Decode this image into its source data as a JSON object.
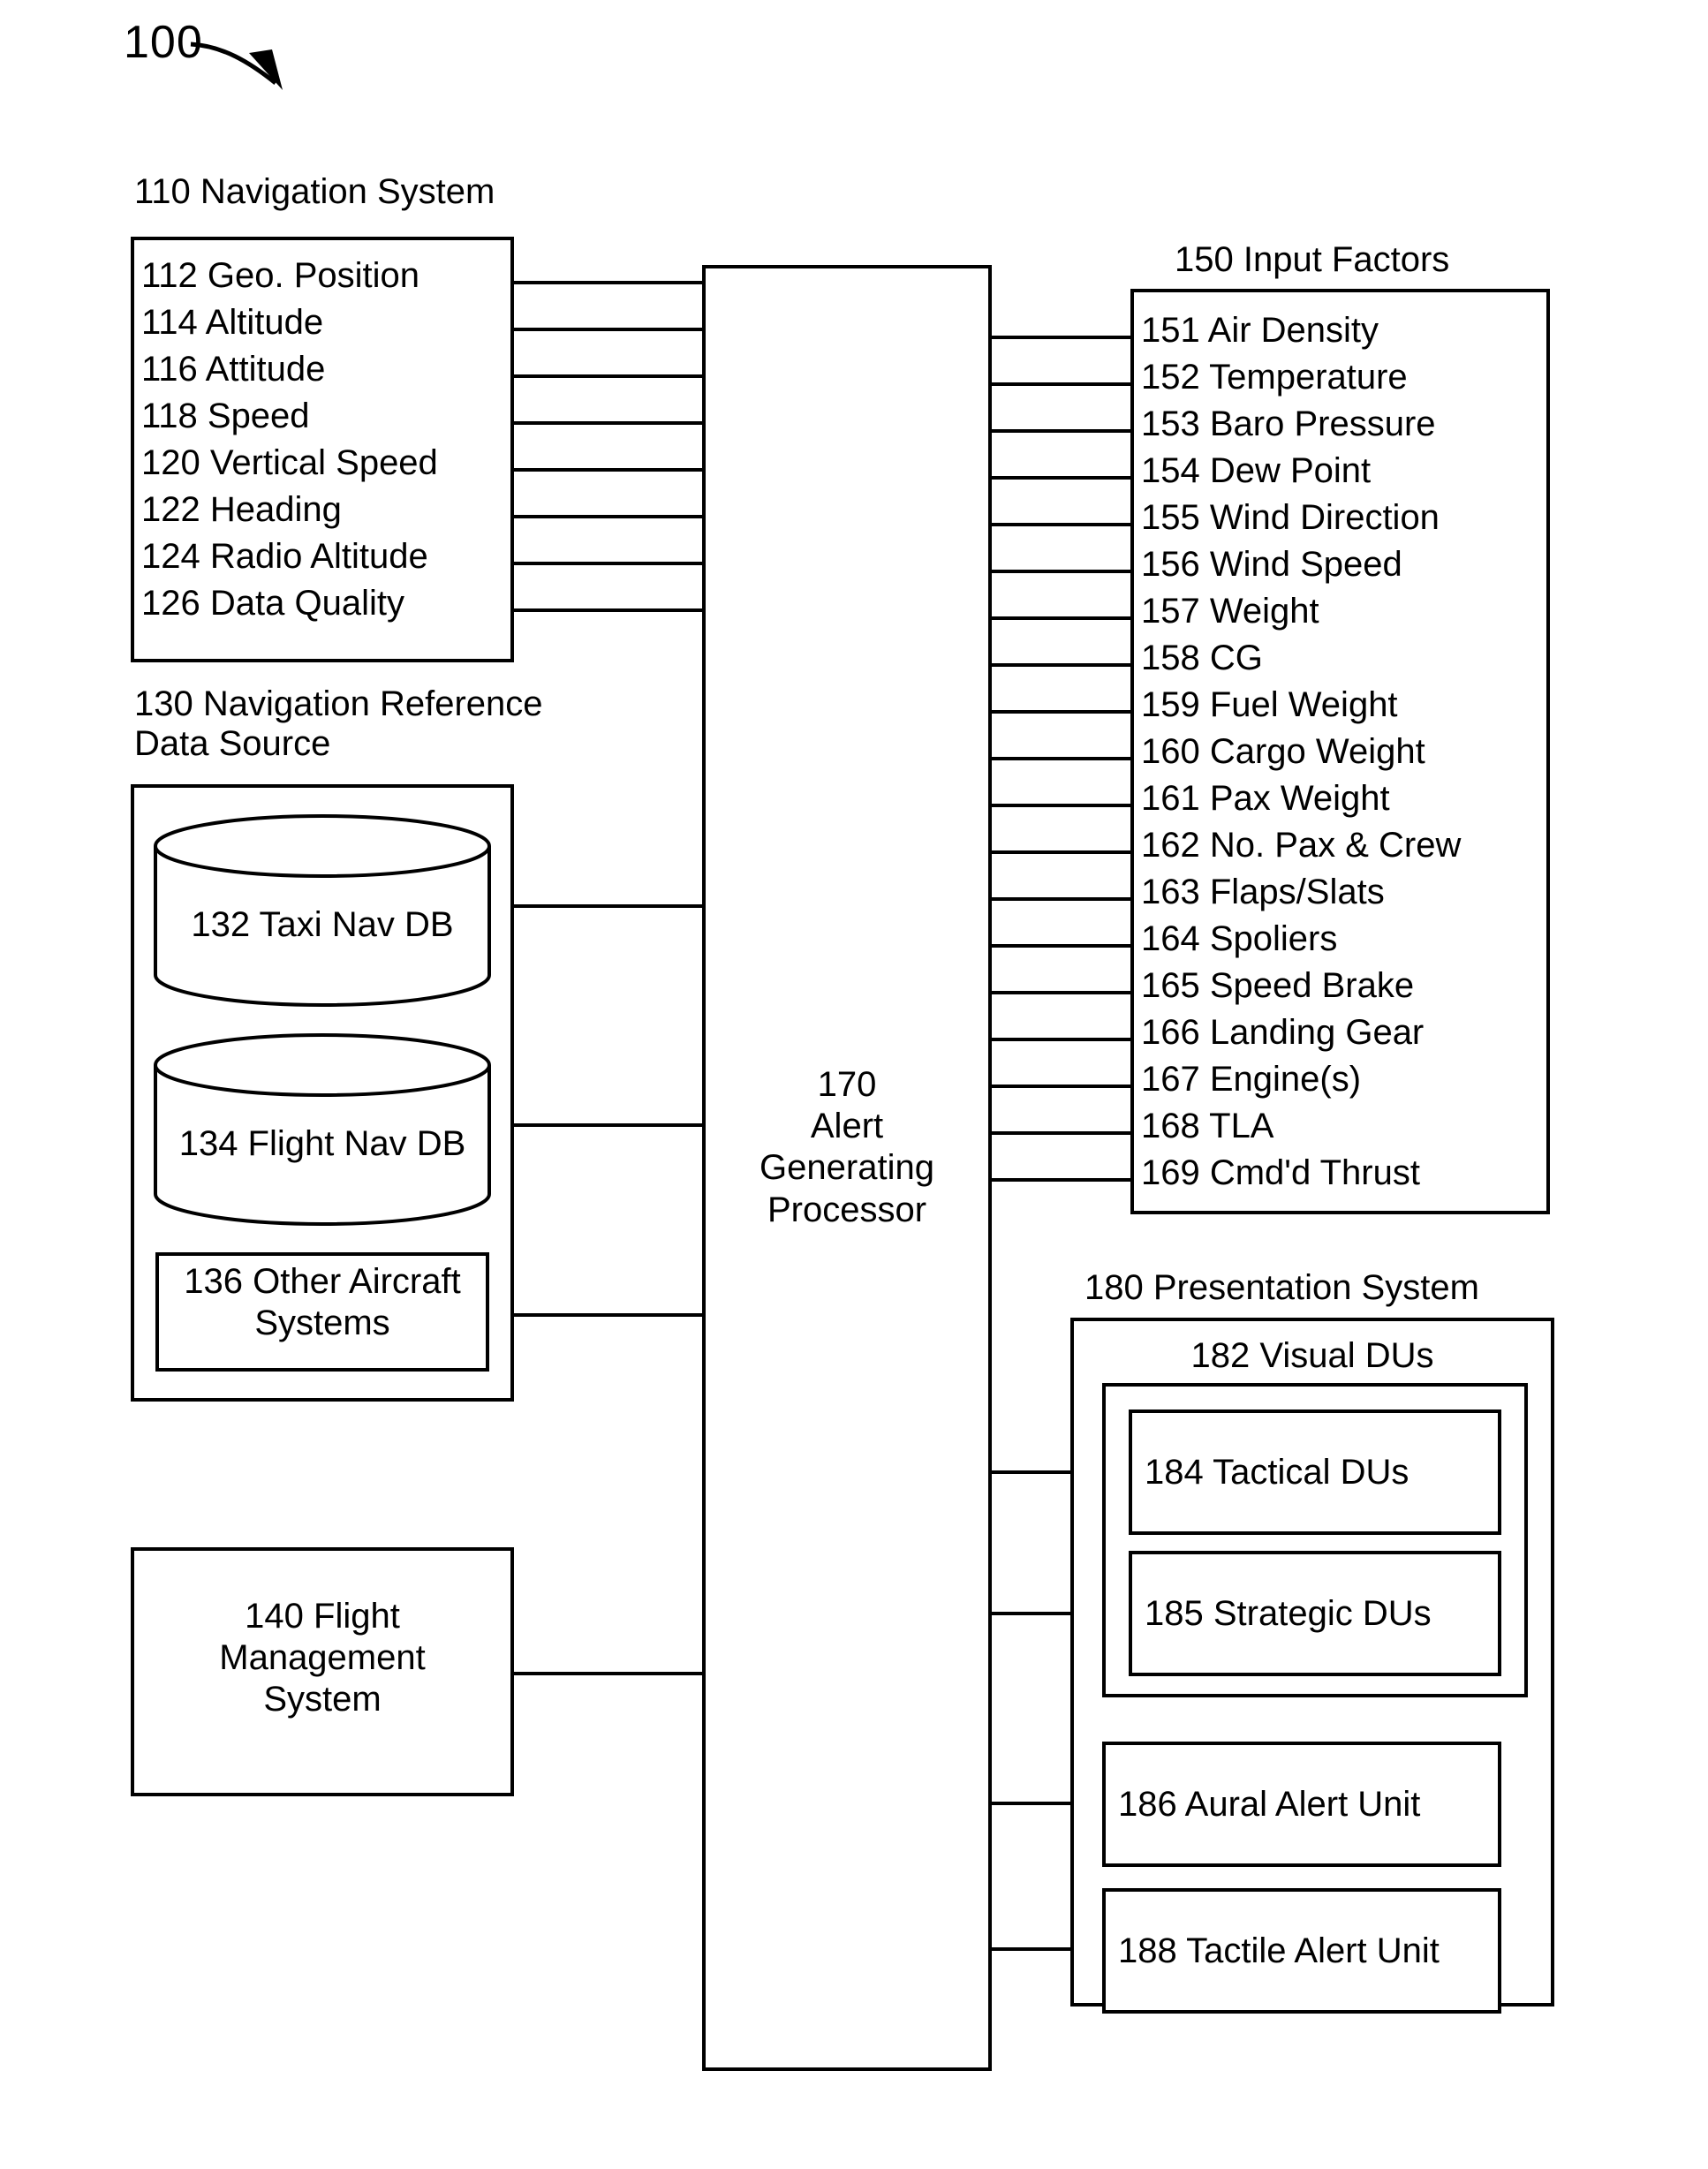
{
  "figure": {
    "number": "100"
  },
  "navigation_system": {
    "caption": "110 Navigation System",
    "items": [
      "112 Geo. Position",
      "114 Altitude",
      "116 Attitude",
      "118 Speed",
      "120 Vertical Speed",
      "122 Heading",
      "124 Radio Altitude",
      "126 Data Quality"
    ]
  },
  "nav_reference_data_source": {
    "caption": "130 Navigation Reference\nData Source",
    "taxi_db": "132 Taxi Nav DB",
    "flight_db": "134 Flight Nav DB",
    "other_systems": "136 Other Aircraft\nSystems"
  },
  "flight_management_system": {
    "label": "140 Flight\nManagement\nSystem"
  },
  "alert_generating_processor": {
    "label": "170\nAlert\nGenerating\nProcessor"
  },
  "input_factors": {
    "caption": "150 Input Factors",
    "items": [
      "151 Air Density",
      "152 Temperature",
      "153 Baro Pressure",
      "154 Dew Point",
      "155 Wind Direction",
      "156 Wind Speed",
      "157 Weight",
      "158 CG",
      "159 Fuel Weight",
      "160 Cargo Weight",
      "161 Pax Weight",
      "162 No. Pax & Crew",
      "163 Flaps/Slats",
      "164 Spoliers",
      "165 Speed Brake",
      "166 Landing Gear",
      "167 Engine(s)",
      "168 TLA",
      "169 Cmd'd Thrust"
    ]
  },
  "presentation_system": {
    "caption": "180 Presentation System",
    "visual_dus_caption": "182 Visual DUs",
    "tactical_dus": "184 Tactical DUs",
    "strategic_dus": "185 Strategic DUs",
    "aural_alert_unit": "186 Aural Alert Unit",
    "tactile_alert_unit": "188 Tactile Alert Unit"
  },
  "colors": {
    "line": "#000000",
    "background": "#ffffff"
  }
}
